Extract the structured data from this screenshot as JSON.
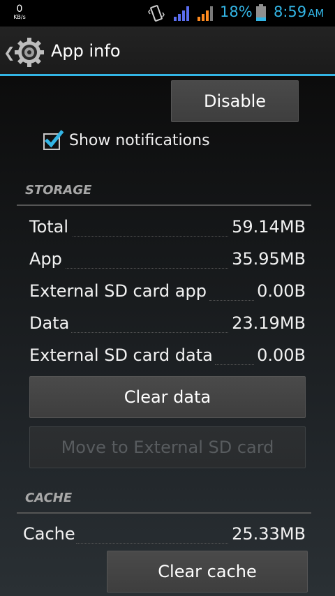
{
  "status_bar": {
    "net_speed": "0",
    "net_unit": "KB/s",
    "battery_percent": "18%",
    "time": "8:59",
    "ampm": "AM",
    "icons": [
      "vibrate-icon",
      "signal-icon",
      "signal-icon",
      "battery-icon"
    ],
    "accent_color": "#33b5e5"
  },
  "action_bar": {
    "title": "App info",
    "icon": "settings-gear-icon"
  },
  "controls": {
    "disable_label": "Disable",
    "show_notifications_label": "Show notifications",
    "show_notifications_checked": true
  },
  "storage": {
    "header": "STORAGE",
    "rows": [
      {
        "label": "Total",
        "value": "59.14MB"
      },
      {
        "label": "App",
        "value": "35.95MB"
      },
      {
        "label": "External SD card app",
        "value": "0.00B"
      },
      {
        "label": "Data",
        "value": "23.19MB"
      },
      {
        "label": "External SD card data",
        "value": "0.00B"
      }
    ],
    "clear_data_label": "Clear data",
    "move_label": "Move to External SD card"
  },
  "cache": {
    "header": "CACHE",
    "label": "Cache",
    "value": "25.33MB",
    "clear_cache_label": "Clear cache"
  }
}
